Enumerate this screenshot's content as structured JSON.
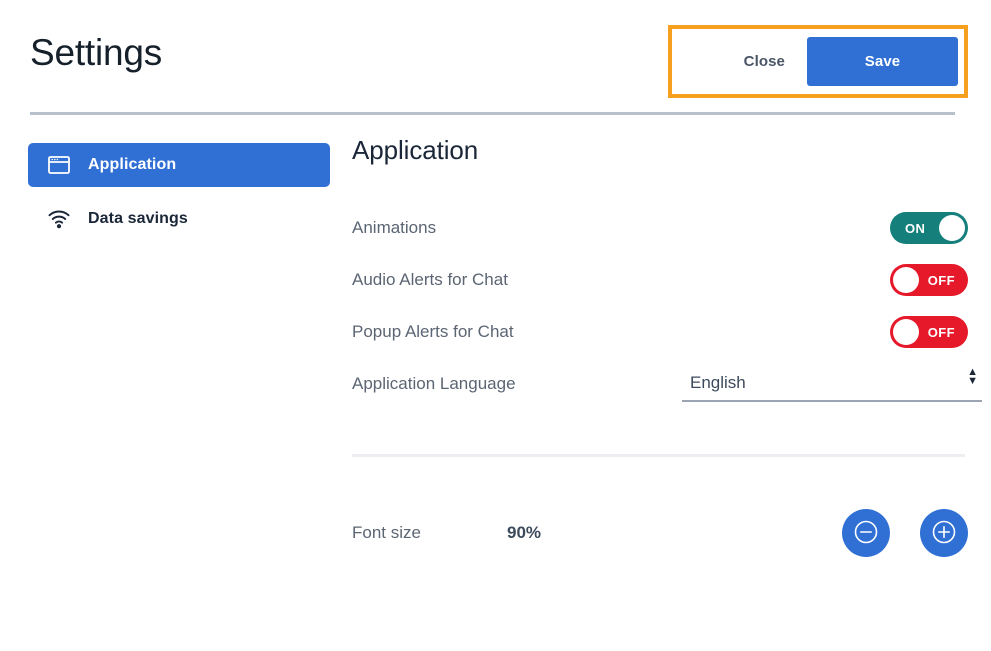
{
  "header": {
    "title": "Settings",
    "close_label": "Close",
    "save_label": "Save",
    "highlight_color": "#f79f1f",
    "accent_color": "#3070d4"
  },
  "sidebar": {
    "items": [
      {
        "label": "Application",
        "icon": "window-icon",
        "active": true
      },
      {
        "label": "Data savings",
        "icon": "wifi-icon",
        "active": false
      }
    ]
  },
  "main": {
    "heading": "Application",
    "settings": [
      {
        "label": "Animations",
        "type": "toggle",
        "state": "ON",
        "color": "#157f7b"
      },
      {
        "label": "Audio Alerts for Chat",
        "type": "toggle",
        "state": "OFF",
        "color": "#e6192b"
      },
      {
        "label": "Popup Alerts for Chat",
        "type": "toggle",
        "state": "OFF",
        "color": "#e6192b"
      },
      {
        "label": "Application Language",
        "type": "select",
        "value": "English"
      }
    ],
    "font_size": {
      "label": "Font size",
      "value": "90%",
      "decrease_icon": "minus-circle-icon",
      "increase_icon": "plus-circle-icon"
    }
  }
}
